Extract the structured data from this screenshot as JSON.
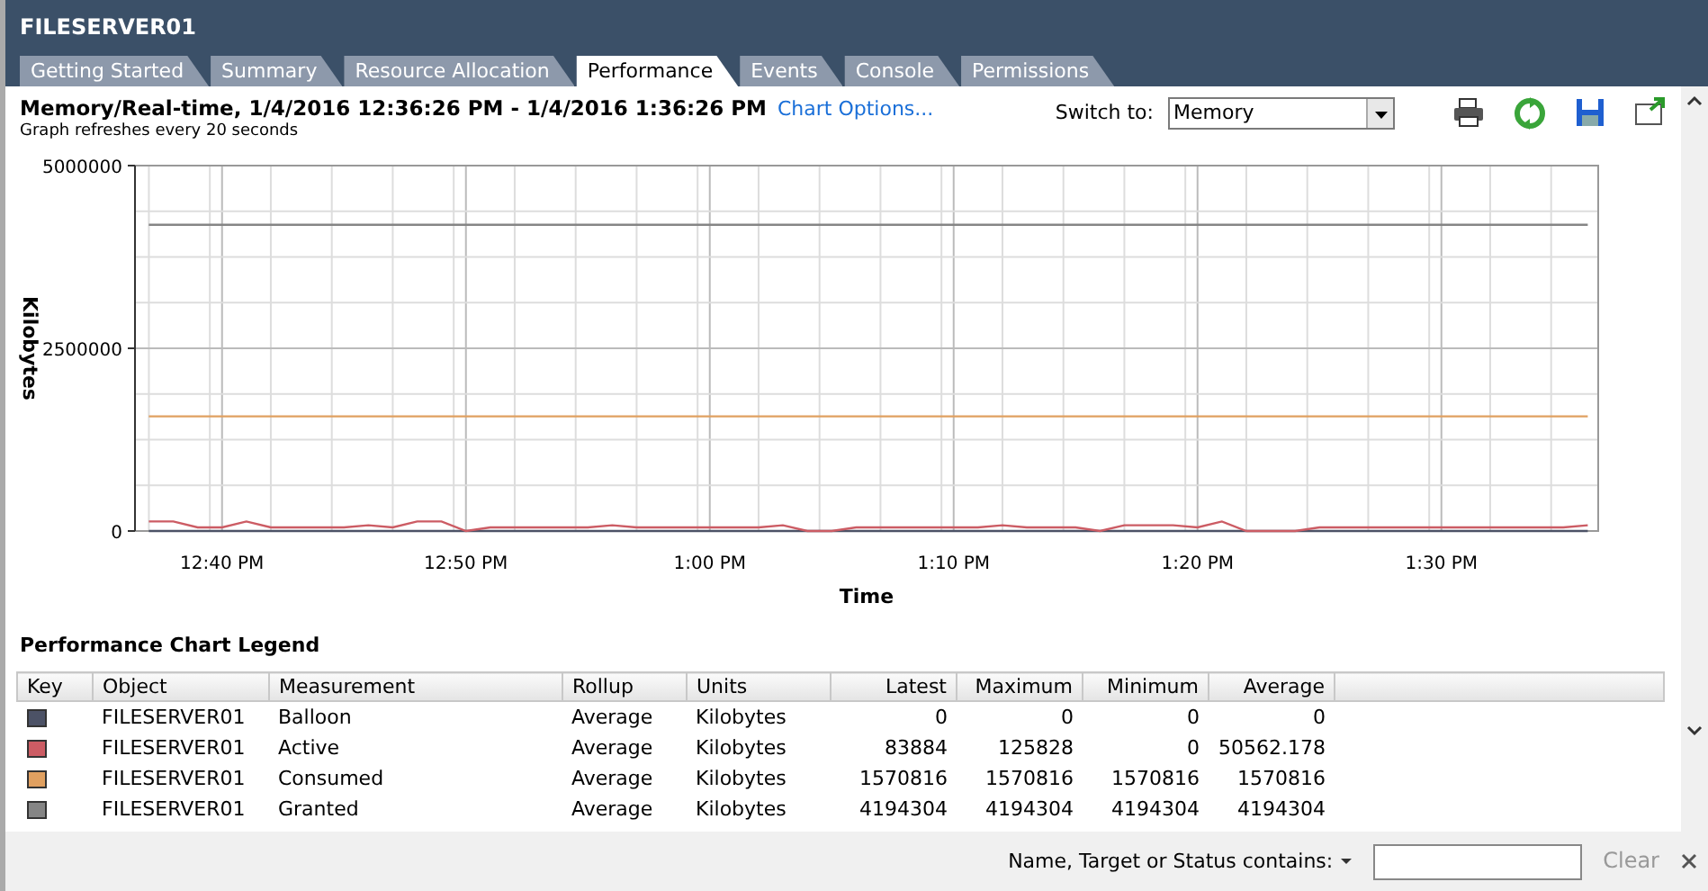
{
  "window": {
    "title": "FILESERVER01"
  },
  "tabs": [
    {
      "label": "Getting Started",
      "selected": false
    },
    {
      "label": "Summary",
      "selected": false
    },
    {
      "label": "Resource Allocation",
      "selected": false
    },
    {
      "label": "Performance",
      "selected": true
    },
    {
      "label": "Events",
      "selected": false
    },
    {
      "label": "Console",
      "selected": false
    },
    {
      "label": "Permissions",
      "selected": false
    }
  ],
  "chart_header": {
    "title": "Memory/Real-time, 1/4/2016 12:36:26 PM - 1/4/2016 1:36:26 PM",
    "link": "Chart Options...",
    "subtitle": "Graph refreshes every 20 seconds",
    "switch_label": "Switch to:",
    "switch_value": "Memory"
  },
  "chart": {
    "chart_data": {
      "type": "line",
      "grid": true,
      "xlabel": "Time",
      "ylabel": "Kilobytes",
      "categories": [
        null,
        null,
        null,
        "12:40 PM",
        null,
        null,
        null,
        null,
        null,
        null,
        null,
        null,
        null,
        "12:50 PM",
        null,
        null,
        null,
        null,
        null,
        null,
        null,
        null,
        null,
        "1:00 PM",
        null,
        null,
        null,
        null,
        null,
        null,
        null,
        null,
        null,
        "1:10 PM",
        null,
        null,
        null,
        null,
        null,
        null,
        null,
        null,
        null,
        "1:20 PM",
        null,
        null,
        null,
        null,
        null,
        null,
        null,
        null,
        null,
        "1:30 PM",
        null,
        null,
        null,
        null,
        null,
        null
      ],
      "ylim": [
        0,
        5000000
      ],
      "yticks": [
        0,
        2500000,
        5000000
      ],
      "series": [
        {
          "name": "Balloon",
          "color": "#4c5266",
          "values": [
            0,
            0,
            0,
            0,
            0,
            0,
            0,
            0,
            0,
            0,
            0,
            0,
            0,
            0,
            0,
            0,
            0,
            0,
            0,
            0,
            0,
            0,
            0,
            0,
            0,
            0,
            0,
            0,
            0,
            0,
            0,
            0,
            0,
            0,
            0,
            0,
            0,
            0,
            0,
            0,
            0,
            0,
            0,
            0,
            0,
            0,
            0,
            0,
            0,
            0,
            0,
            0,
            0,
            0,
            0,
            0,
            0,
            0,
            0,
            0
          ]
        },
        {
          "name": "Active",
          "color": "#cc5c64",
          "values": [
            130000,
            130000,
            50000,
            50000,
            130000,
            50000,
            50000,
            50000,
            50000,
            80000,
            50000,
            130000,
            130000,
            0,
            50000,
            50000,
            50000,
            50000,
            50000,
            80000,
            50000,
            50000,
            50000,
            50000,
            50000,
            50000,
            80000,
            0,
            0,
            50000,
            50000,
            50000,
            50000,
            50000,
            50000,
            80000,
            50000,
            50000,
            50000,
            0,
            80000,
            80000,
            80000,
            50000,
            130000,
            0,
            0,
            0,
            50000,
            50000,
            50000,
            50000,
            50000,
            50000,
            50000,
            50000,
            50000,
            50000,
            50000,
            80000
          ]
        },
        {
          "name": "Consumed",
          "color": "#e0a060",
          "values": [
            1570000,
            1570000,
            1570000,
            1570000,
            1570000,
            1570000,
            1570000,
            1570000,
            1570000,
            1570000,
            1570000,
            1570000,
            1570000,
            1570000,
            1570000,
            1570000,
            1570000,
            1570000,
            1570000,
            1570000,
            1570000,
            1570000,
            1570000,
            1570000,
            1570000,
            1570000,
            1570000,
            1570000,
            1570000,
            1570000,
            1570000,
            1570000,
            1570000,
            1570000,
            1570000,
            1570000,
            1570000,
            1570000,
            1570000,
            1570000,
            1570000,
            1570000,
            1570000,
            1570000,
            1570000,
            1570000,
            1570000,
            1570000,
            1570000,
            1570000,
            1570000,
            1570000,
            1570000,
            1570000,
            1570000,
            1570000,
            1570000,
            1570000,
            1570000,
            1570000
          ]
        },
        {
          "name": "Granted",
          "color": "#858585",
          "values": [
            4190000,
            4190000,
            4190000,
            4190000,
            4190000,
            4190000,
            4190000,
            4190000,
            4190000,
            4190000,
            4190000,
            4190000,
            4190000,
            4190000,
            4190000,
            4190000,
            4190000,
            4190000,
            4190000,
            4190000,
            4190000,
            4190000,
            4190000,
            4190000,
            4190000,
            4190000,
            4190000,
            4190000,
            4190000,
            4190000,
            4190000,
            4190000,
            4190000,
            4190000,
            4190000,
            4190000,
            4190000,
            4190000,
            4190000,
            4190000,
            4190000,
            4190000,
            4190000,
            4190000,
            4190000,
            4190000,
            4190000,
            4190000,
            4190000,
            4190000,
            4190000,
            4190000,
            4190000,
            4190000,
            4190000,
            4190000,
            4190000,
            4190000,
            4190000,
            4190000
          ]
        }
      ]
    }
  },
  "legend": {
    "title": "Performance Chart Legend",
    "columns": [
      "Key",
      "Object",
      "Measurement",
      "Rollup",
      "Units",
      "Latest",
      "Maximum",
      "Minimum",
      "Average"
    ],
    "rows": [
      {
        "object": "FILESERVER01",
        "rollup": "Average",
        "units": "Kilobytes",
        "latest": "0",
        "maximum": "0",
        "minimum": "0",
        "average": "0"
      },
      {
        "object": "FILESERVER01",
        "rollup": "Average",
        "units": "Kilobytes",
        "latest": "83884",
        "maximum": "125828",
        "minimum": "0",
        "average": "50562.178"
      },
      {
        "object": "FILESERVER01",
        "rollup": "Average",
        "units": "Kilobytes",
        "latest": "1570816",
        "maximum": "1570816",
        "minimum": "1570816",
        "average": "1570816"
      },
      {
        "object": "FILESERVER01",
        "rollup": "Average",
        "units": "Kilobytes",
        "latest": "4194304",
        "maximum": "4194304",
        "minimum": "4194304",
        "average": "4194304"
      }
    ]
  },
  "filter_bar": {
    "label": "Name, Target or Status contains:",
    "clear": "Clear",
    "clear_disabled": true
  }
}
